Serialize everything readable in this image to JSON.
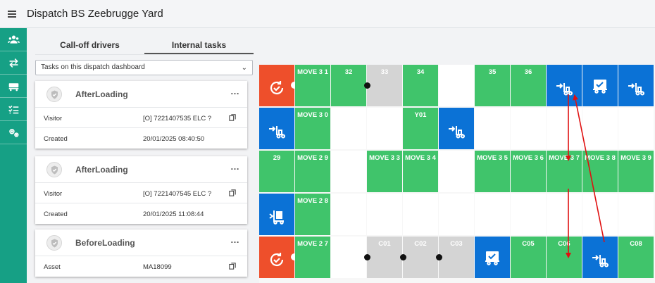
{
  "header": {
    "title": "Dispatch BS Zeebrugge Yard",
    "menu_icon": "hamburger-icon"
  },
  "sidebar": {
    "items": [
      {
        "name": "drivers",
        "icon": "users-icon"
      },
      {
        "name": "transfers",
        "icon": "swap-arrows-icon"
      },
      {
        "name": "trucks",
        "icon": "truck-icon"
      },
      {
        "name": "tasks",
        "icon": "checklist-icon"
      },
      {
        "name": "settings",
        "icon": "gears-icon"
      }
    ]
  },
  "panel": {
    "tabs": [
      {
        "label": "Call-off drivers",
        "active": false
      },
      {
        "label": "Internal tasks",
        "active": true
      }
    ],
    "filter": {
      "value": "Tasks on this dispatch dashboard"
    },
    "cards": [
      {
        "title": "AfterLoading",
        "rows": [
          {
            "label": "Visitor",
            "value": "[O] 7221407535 ELC ?",
            "copy": true
          },
          {
            "label": "Created",
            "value": "20/01/2025 08:40:50",
            "copy": false
          }
        ]
      },
      {
        "title": "AfterLoading",
        "rows": [
          {
            "label": "Visitor",
            "value": "[O] 7221407545 ELC ?",
            "copy": true
          },
          {
            "label": "Created",
            "value": "20/01/2025 11:08:44",
            "copy": false
          }
        ]
      },
      {
        "title": "BeforeLoading",
        "rows": [
          {
            "label": "Asset",
            "value": "MA18099",
            "copy": true
          }
        ]
      }
    ]
  },
  "yard": {
    "colors": {
      "green": "#40c46b",
      "blue": "#0b72d6",
      "red": "#ee4f2b",
      "grey": "#d4d4d4",
      "arrow": "#e01010"
    },
    "rows": [
      [
        {
          "type": "red",
          "icon": "refresh-check-icon"
        },
        {
          "type": "green",
          "label": "MOVE 3 1"
        },
        {
          "type": "green",
          "label": "32"
        },
        {
          "type": "grey",
          "label": "33",
          "dot": true
        },
        {
          "type": "green",
          "label": "34"
        },
        {
          "type": "empty"
        },
        {
          "type": "green",
          "label": "35"
        },
        {
          "type": "green",
          "label": "36"
        },
        {
          "type": "blue",
          "icon": "forklift-icon"
        },
        {
          "type": "blue",
          "icon": "check-truck-icon"
        },
        {
          "type": "blue",
          "icon": "forklift-icon"
        }
      ],
      [
        {
          "type": "blue",
          "icon": "forklift-icon"
        },
        {
          "type": "green",
          "label": "MOVE 3 0"
        },
        {
          "type": "empty"
        },
        {
          "type": "empty"
        },
        {
          "type": "green",
          "label": "Y01"
        },
        {
          "type": "blue",
          "icon": "forklift-icon"
        },
        {
          "type": "empty"
        },
        {
          "type": "empty"
        },
        {
          "type": "empty"
        },
        {
          "type": "empty"
        },
        {
          "type": "empty"
        }
      ],
      [
        {
          "type": "green",
          "label": "29"
        },
        {
          "type": "green",
          "label": "MOVE 2 9"
        },
        {
          "type": "empty"
        },
        {
          "type": "green",
          "label": "MOVE 3 3"
        },
        {
          "type": "green",
          "label": "MOVE 3 4"
        },
        {
          "type": "empty"
        },
        {
          "type": "green",
          "label": "MOVE 3 5"
        },
        {
          "type": "green",
          "label": "MOVE 3 6"
        },
        {
          "type": "green",
          "label": "MOVE 3 7"
        },
        {
          "type": "green",
          "label": "MOVE 3 8"
        },
        {
          "type": "green",
          "label": "MOVE 3 9"
        }
      ],
      [
        {
          "type": "blue",
          "icon": "loaded-trolley-icon"
        },
        {
          "type": "green",
          "label": "MOVE 2 8"
        },
        {
          "type": "empty"
        },
        {
          "type": "empty"
        },
        {
          "type": "empty"
        },
        {
          "type": "empty"
        },
        {
          "type": "empty"
        },
        {
          "type": "empty"
        },
        {
          "type": "empty"
        },
        {
          "type": "empty"
        },
        {
          "type": "empty"
        }
      ],
      [
        {
          "type": "red",
          "icon": "refresh-check-icon"
        },
        {
          "type": "green",
          "label": "MOVE 2 7"
        },
        {
          "type": "empty"
        },
        {
          "type": "grey",
          "label": "C01",
          "dot": true
        },
        {
          "type": "grey",
          "label": "C02",
          "dot": true
        },
        {
          "type": "grey",
          "label": "C03",
          "dot": true
        },
        {
          "type": "blue",
          "icon": "check-truck-icon"
        },
        {
          "type": "green",
          "label": "C05"
        },
        {
          "type": "green",
          "label": "C06"
        },
        {
          "type": "blue",
          "icon": "forklift-icon"
        },
        {
          "type": "green",
          "label": "C08"
        }
      ]
    ]
  }
}
